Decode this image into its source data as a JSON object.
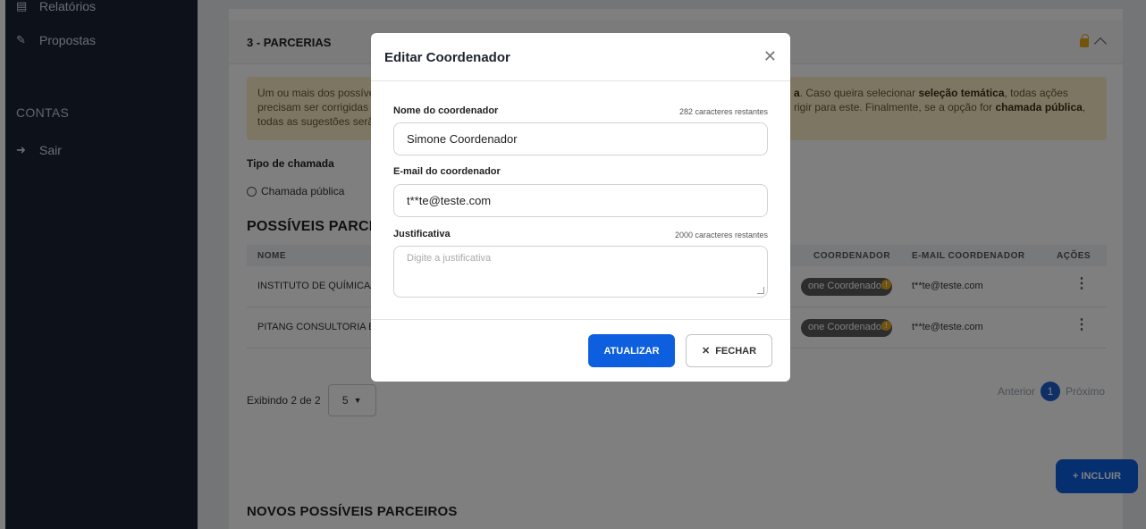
{
  "sidebar": {
    "items": [
      {
        "label": "Relatórios",
        "icon": "report-icon"
      },
      {
        "label": "Propostas",
        "icon": "edit-document-icon"
      }
    ],
    "section": "CONTAS",
    "logout": {
      "label": "Sair",
      "icon": "sign-out-icon"
    }
  },
  "section": {
    "title": "3 - PARCERIAS",
    "alert": {
      "line1_start": "Um ou mais dos possíve",
      "line1_end_bold": "a",
      "line1_end": ". Caso queira selecionar ",
      "line1_bold2": "seleção temática",
      "line1_tail": ", todas ações",
      "line2_start": "precisam ser corrigidas",
      "line2_end": "rigir para este. Finalmente, se a opção for ",
      "line2_bold": "chamada pública",
      "line2_tail": ",",
      "line3": "todas as sugestões serã"
    },
    "call_type_label": "Tipo de chamada",
    "call_type_option": "Chamada pública",
    "partners_title": "POSSÍVEIS PARCEIRO",
    "table": {
      "headers": {
        "name": "NOME",
        "coordinator": "COORDENADOR",
        "email": "E-MAIL COORDENADOR",
        "actions": "AÇÕES"
      },
      "rows": [
        {
          "name": "INSTITUTO DE QUÍMICA/I",
          "coordinator": "one Coordenador",
          "email": "t**te@teste.com"
        },
        {
          "name": "PITANG CONSULTORIA E",
          "coordinator": "one Coordenador",
          "email": "t**te@teste.com"
        }
      ]
    },
    "showing": "Exibindo 2 de 2",
    "per_page": "5",
    "pager": {
      "prev": "Anterior",
      "current": "1",
      "next": "Próximo"
    },
    "include_button": "+ INCLUIR",
    "new_partners_title": "NOVOS POSSÍVEIS PARCEIROS"
  },
  "modal": {
    "title": "Editar Coordenador",
    "name_label": "Nome do coordenador",
    "name_hint": "282 caracteres restantes",
    "name_value": "Simone Coordenador",
    "email_label": "E-mail do coordenador",
    "email_value": "t**te@teste.com",
    "justification_label": "Justificativa",
    "justification_hint": "2000 caracteres restantes",
    "justification_placeholder": "Digite a justificativa",
    "update_button": "ATUALIZAR",
    "close_button": "FECHAR"
  },
  "colors": {
    "primary": "#0d5fe0",
    "sidebar": "#1a2235",
    "alert_bg": "#fbedc6",
    "warning": "#e4a81a"
  }
}
